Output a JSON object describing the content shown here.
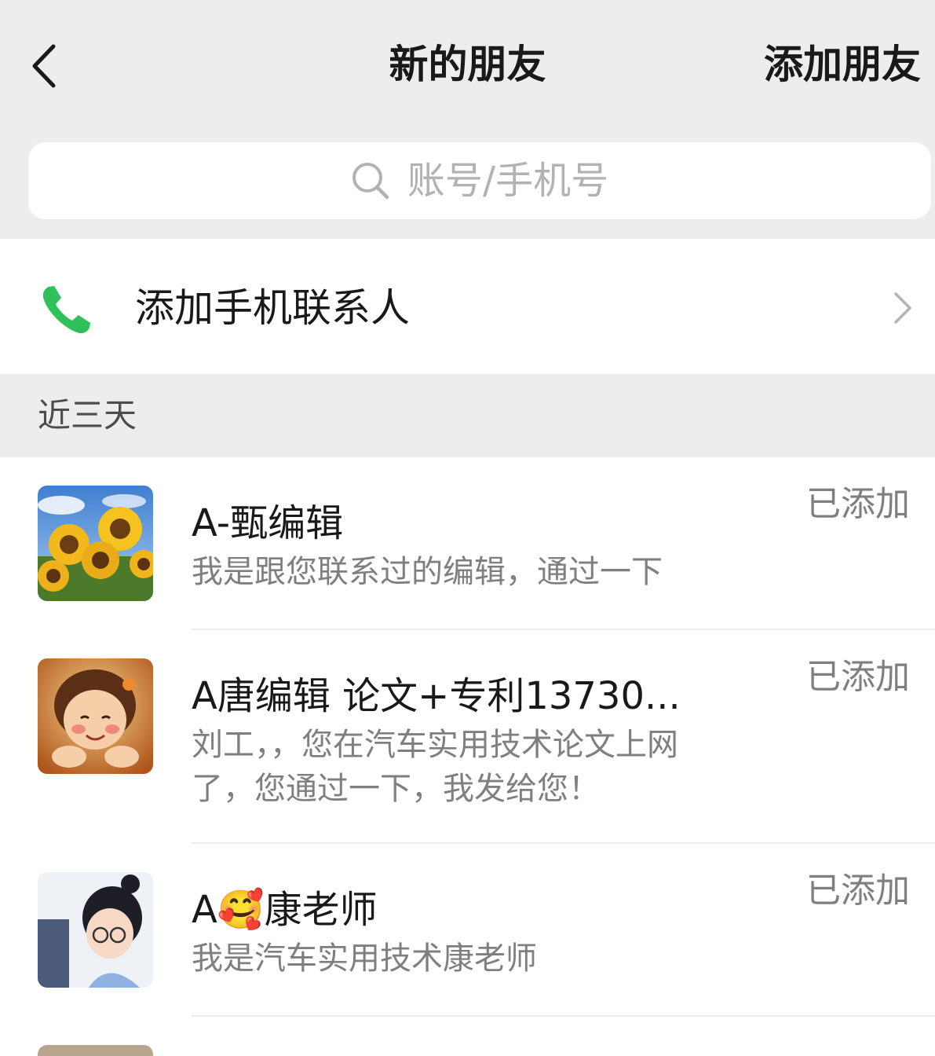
{
  "header": {
    "title": "新的朋友",
    "action_label": "添加朋友"
  },
  "search": {
    "placeholder": "账号/手机号"
  },
  "phone_contacts": {
    "label": "添加手机联系人",
    "icon_color": "#2ec05a"
  },
  "section": {
    "label": "近三天"
  },
  "friends": [
    {
      "name": "A-甄编辑",
      "message": "我是跟您联系过的编辑，通过一下",
      "status": "已添加",
      "avatar": "sunflower-avatar"
    },
    {
      "name": "A唐编辑  论文+专利13730...",
      "message": "刘工，，您在汽车实用技术论文上网了，您通过一下，我发给您！",
      "status": "已添加",
      "avatar": "cartoon-girl-avatar"
    },
    {
      "name": "A🥰康老师",
      "message": "我是汽车实用技术康老师",
      "status": "已添加",
      "avatar": "girl-laptop-avatar"
    }
  ],
  "colors": {
    "background": "#ededed",
    "text_primary": "#191919",
    "text_secondary": "#7f7f7f",
    "placeholder": "#b2b2b2",
    "accent_green": "#2ec05a"
  }
}
